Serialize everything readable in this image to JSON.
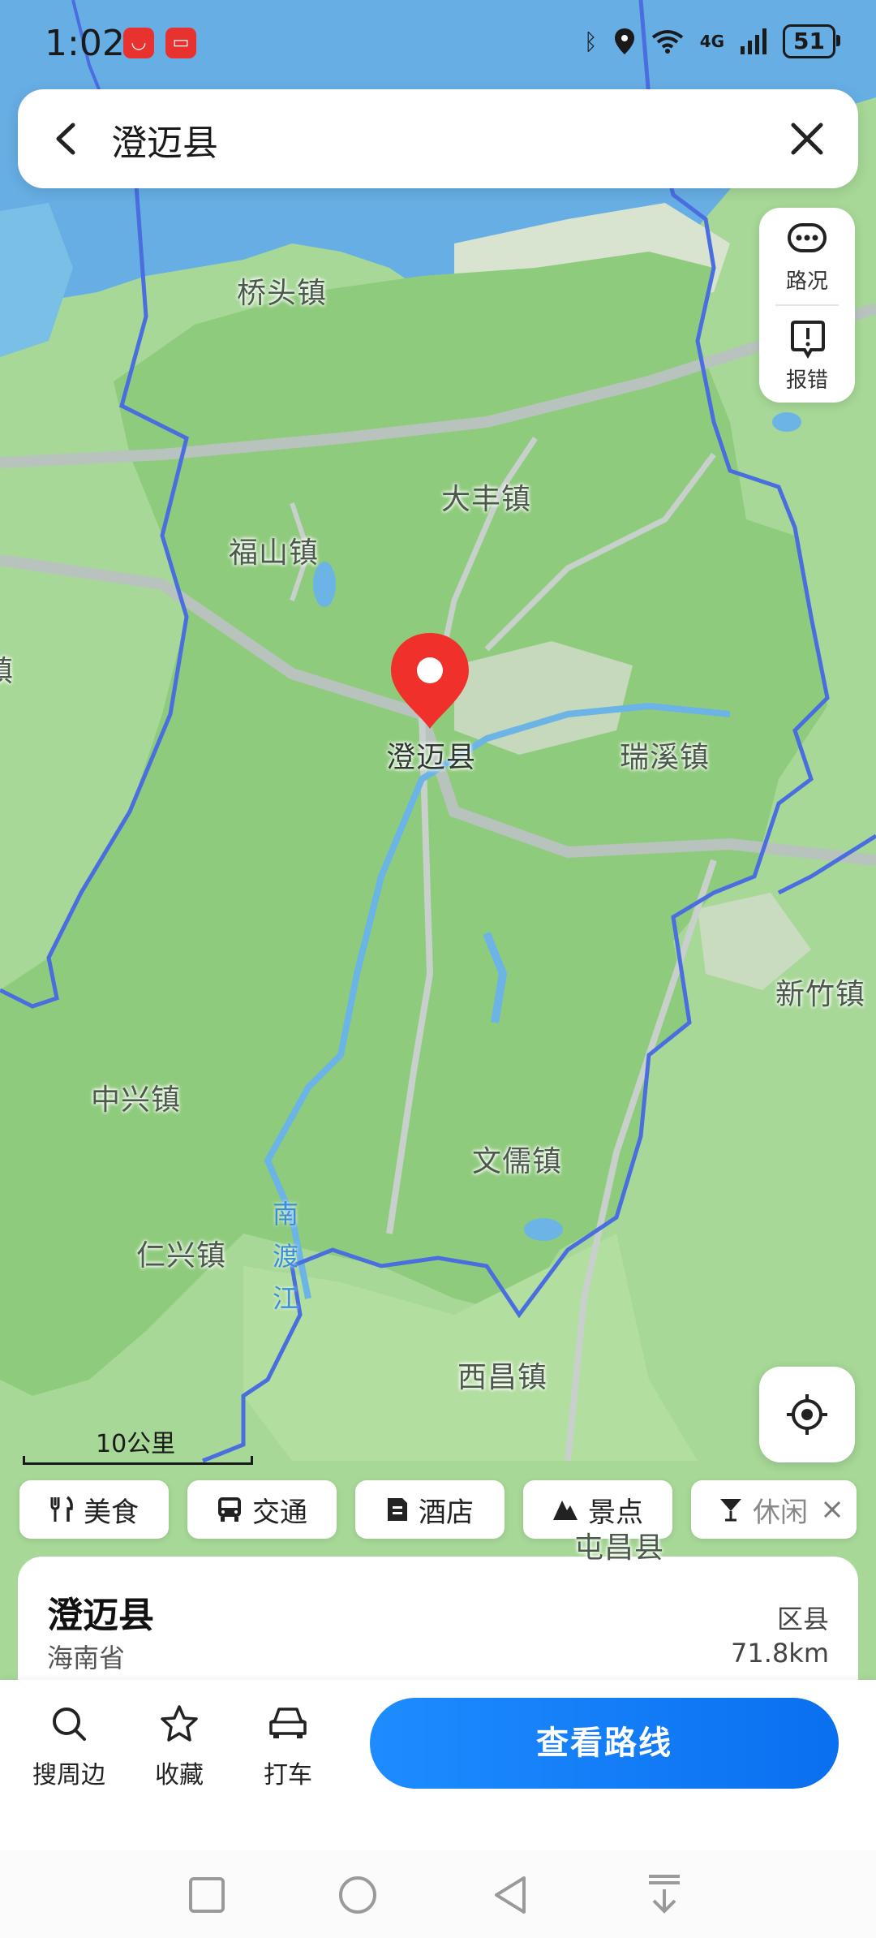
{
  "status_bar": {
    "time": "1:02",
    "network": "4G",
    "battery": "51"
  },
  "search": {
    "query": "澄迈县"
  },
  "map": {
    "side_buttons": [
      {
        "label": "路况"
      },
      {
        "label": "报错"
      }
    ],
    "towns": [
      {
        "name": "桥头镇"
      },
      {
        "name": "大丰镇"
      },
      {
        "name": "福山镇"
      },
      {
        "name": "瑞溪镇"
      },
      {
        "name": "新竹镇"
      },
      {
        "name": "中兴镇"
      },
      {
        "name": "文儒镇"
      },
      {
        "name": "仁兴镇"
      },
      {
        "name": "西昌镇"
      },
      {
        "name": "屯昌县"
      },
      {
        "name": "镇"
      }
    ],
    "river_label": "南渡江",
    "marker_label": "澄迈县",
    "scale": "10公里"
  },
  "categories": [
    {
      "label": "美食",
      "icon": "fork-knife-icon"
    },
    {
      "label": "交通",
      "icon": "bus-icon"
    },
    {
      "label": "酒店",
      "icon": "hotel-icon"
    },
    {
      "label": "景点",
      "icon": "mountain-icon"
    },
    {
      "label": "休闲",
      "icon": "cocktail-icon"
    }
  ],
  "place": {
    "name": "澄迈县",
    "province": "海南省",
    "type": "区县",
    "distance": "71.8km"
  },
  "actions": [
    {
      "label": "搜周边",
      "icon": "search-icon"
    },
    {
      "label": "收藏",
      "icon": "star-icon"
    },
    {
      "label": "打车",
      "icon": "car-icon"
    }
  ],
  "route_button": "查看路线",
  "colors": {
    "accent": "#1a7cf5",
    "marker": "#f0302a",
    "border": "#4a6ee0",
    "water": "#5aa7e8"
  }
}
